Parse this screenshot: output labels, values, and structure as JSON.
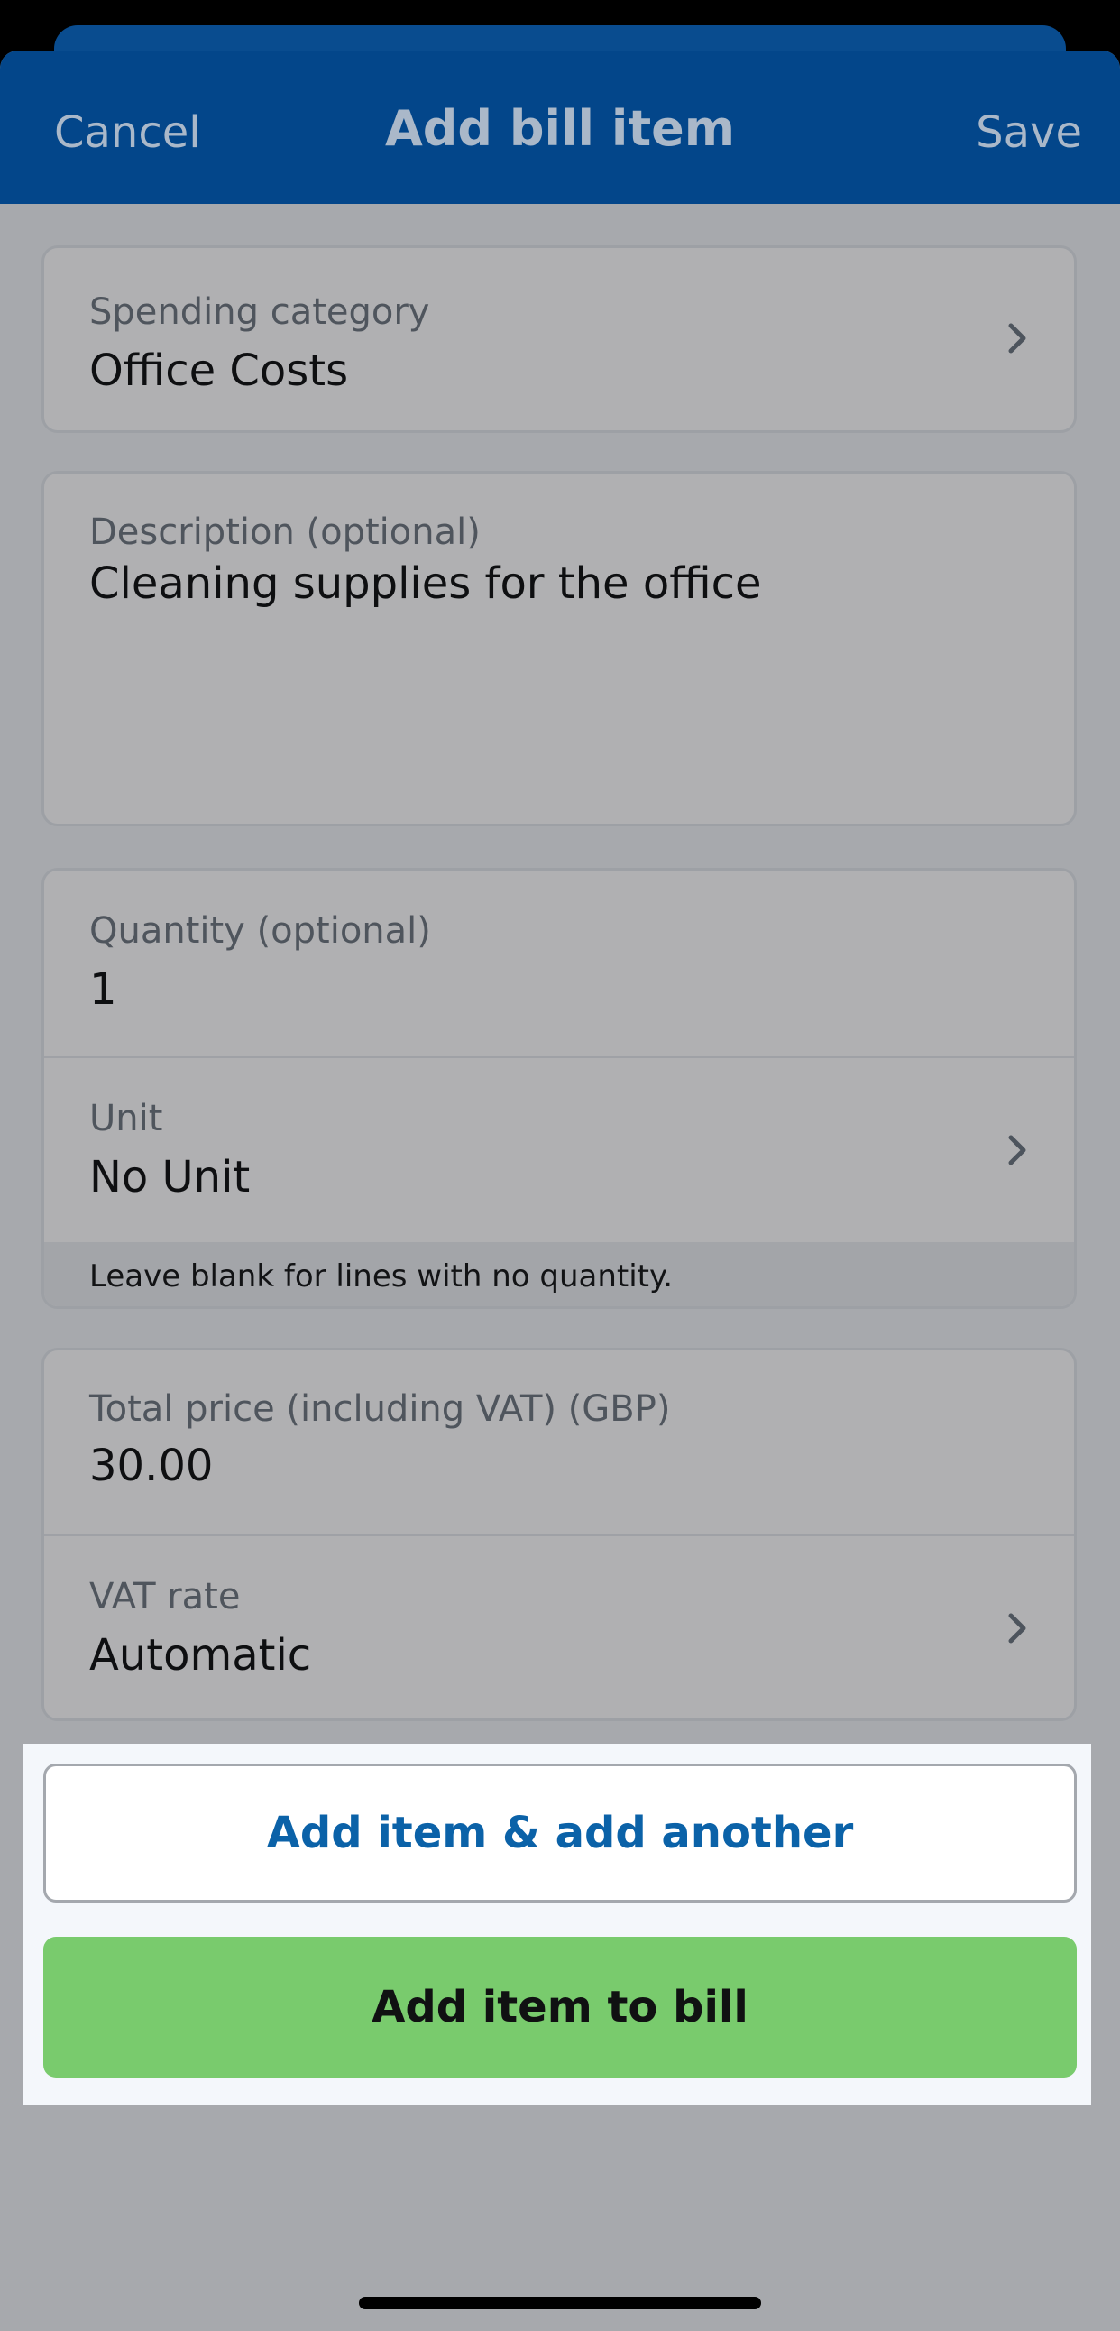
{
  "navbar": {
    "cancel_label": "Cancel",
    "title": "Add bill item",
    "save_label": "Save"
  },
  "spending_category": {
    "label": "Spending category",
    "value": "Office Costs"
  },
  "description": {
    "label": "Description (optional)",
    "value": "Cleaning supplies for the office"
  },
  "quantity": {
    "label": "Quantity (optional)",
    "value": "1"
  },
  "unit": {
    "label": "Unit",
    "value": "No Unit",
    "helper": "Leave blank for lines with no quantity."
  },
  "total_price": {
    "label": "Total price (including VAT) (GBP)",
    "value": "30.00"
  },
  "vat_rate": {
    "label": "VAT rate",
    "value": "Automatic"
  },
  "actions": {
    "add_another_label": "Add item & add another",
    "add_to_bill_label": "Add item to bill"
  },
  "colors": {
    "navbar": "#03468a",
    "accent_blue": "#0b62a8",
    "primary_green": "#79cb6d",
    "dim_overlay": "#a7a9ad"
  },
  "icons": {
    "row_chevron": "chevron-right-icon"
  }
}
